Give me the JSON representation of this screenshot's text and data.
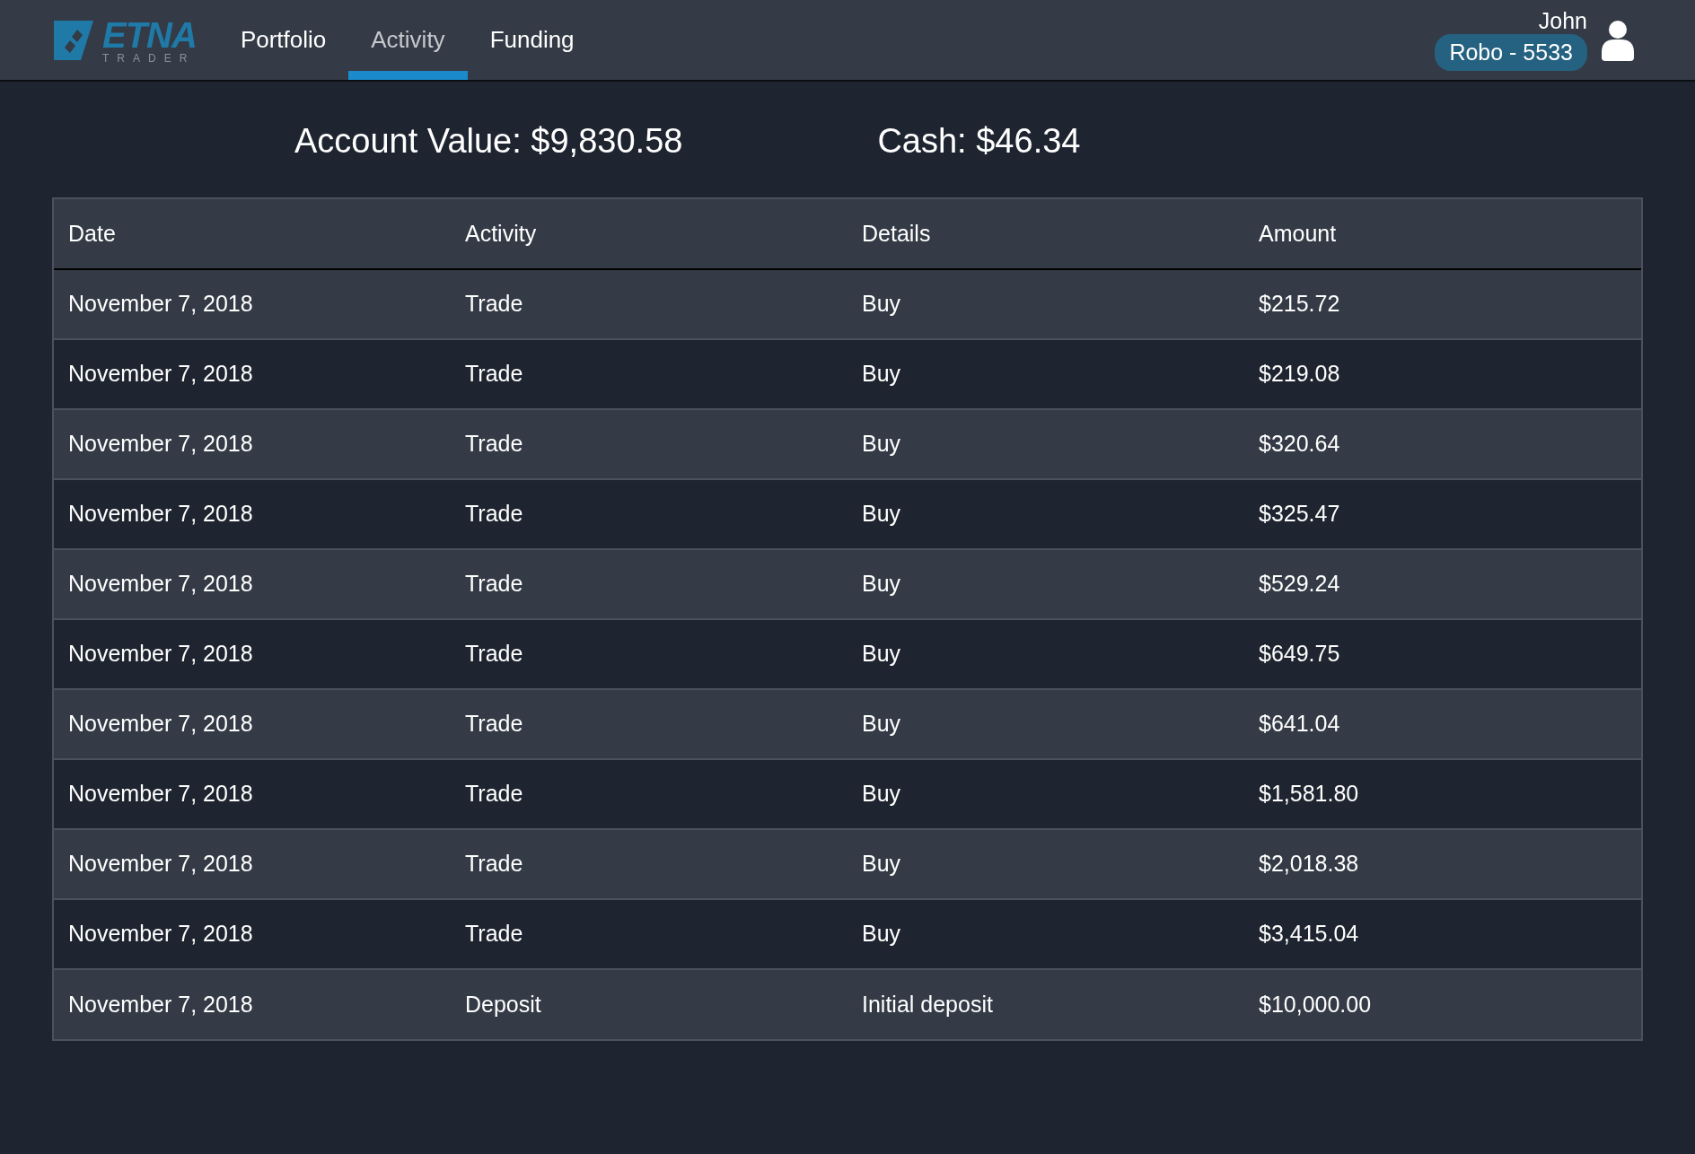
{
  "logo": {
    "name": "ETNA",
    "tagline": "TRADER"
  },
  "nav": [
    {
      "label": "Portfolio",
      "selected": false
    },
    {
      "label": "Activity",
      "selected": true
    },
    {
      "label": "Funding",
      "selected": false
    }
  ],
  "user": {
    "name": "John",
    "account": "Robo - 5533"
  },
  "summary": [
    {
      "text": "Account Value: $9,830.58"
    },
    {
      "text": "Cash: $46.34"
    }
  ],
  "table": {
    "columns": [
      "Date",
      "Activity",
      "Details",
      "Amount"
    ],
    "rows": [
      [
        "November 7, 2018",
        "Trade",
        "Buy",
        "$215.72"
      ],
      [
        "November 7, 2018",
        "Trade",
        "Buy",
        "$219.08"
      ],
      [
        "November 7, 2018",
        "Trade",
        "Buy",
        "$320.64"
      ],
      [
        "November 7, 2018",
        "Trade",
        "Buy",
        "$325.47"
      ],
      [
        "November 7, 2018",
        "Trade",
        "Buy",
        "$529.24"
      ],
      [
        "November 7, 2018",
        "Trade",
        "Buy",
        "$649.75"
      ],
      [
        "November 7, 2018",
        "Trade",
        "Buy",
        "$641.04"
      ],
      [
        "November 7, 2018",
        "Trade",
        "Buy",
        "$1,581.80"
      ],
      [
        "November 7, 2018",
        "Trade",
        "Buy",
        "$2,018.38"
      ],
      [
        "November 7, 2018",
        "Trade",
        "Buy",
        "$3,415.04"
      ],
      [
        "November 7, 2018",
        "Deposit",
        "Initial deposit",
        "$10,000.00"
      ]
    ]
  }
}
